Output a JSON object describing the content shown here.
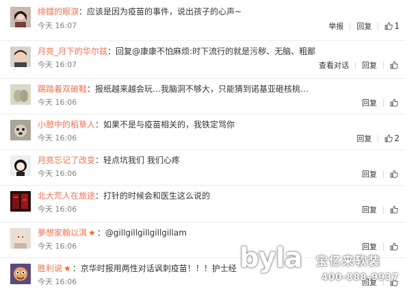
{
  "comments": [
    {
      "username": "绯鐳的眼淚",
      "separator": "：",
      "badge": "",
      "content": "应该是因为疫苗的事件，说出孩子的心声~",
      "time": "今天 16:07",
      "actions": [
        "举报",
        "回复"
      ],
      "likes": "1",
      "avatar": "avatar-woman-icon"
    },
    {
      "username": "月亮_月下的华尔兹",
      "separator": "：",
      "badge": "",
      "content": "回复@康康不怕麻烦:时下流行的就是污秽、无脑、粗鄙",
      "time": "今天 16:07",
      "actions": [
        "查看对话",
        "回复"
      ],
      "likes": "",
      "avatar": "avatar-man-icon"
    },
    {
      "username": "踢踏着双破鞋",
      "separator": "：",
      "badge": "",
      "content": "报纸越来越会玩…我脑洞不够大，只能猜到诺基亚砸核桃…",
      "time": "今天 16:06",
      "actions": [
        "回复"
      ],
      "likes": "",
      "avatar": "avatar-shoes-icon"
    },
    {
      "username": "小憩中的稻草人",
      "separator": "：",
      "badge": "",
      "content": "如果不是与疫苗相关的，我铁定骂你",
      "time": "今天 16:06",
      "actions": [
        "回复"
      ],
      "likes": "2",
      "avatar": "avatar-dog-icon"
    },
    {
      "username": "月亮忘记了改变",
      "separator": "：",
      "badge": "",
      "content": "轻点坑我们 我们心疼",
      "time": "今天 16:06",
      "actions": [
        "回复"
      ],
      "likes": "",
      "avatar": "avatar-girl-icon"
    },
    {
      "username": "北大荒人在旅途",
      "separator": "：",
      "badge": "",
      "content": "打针的时候会和医生这么说的",
      "time": "今天 16:06",
      "actions": [
        "回复"
      ],
      "likes": "",
      "avatar": "avatar-red-text-icon"
    },
    {
      "username": "夢想家翰以淇",
      "separator": "：",
      "badge": "★",
      "content": "@gillgillgillgillgillam",
      "time": "今天 16:06",
      "actions": [
        "回复"
      ],
      "likes": "",
      "avatar": "avatar-baby-icon"
    },
    {
      "username": "胜利说",
      "separator": "：",
      "badge": "★",
      "content": "京华时报用两性对话讽刺疫苗！！！护士经",
      "time": "今天 16:06",
      "actions": [
        "回复"
      ],
      "likes": "",
      "avatar": "avatar-cartoon-icon"
    }
  ],
  "watermark": {
    "logo": "byla",
    "name": "宝亿来软装",
    "phone": "400-888-9937"
  }
}
